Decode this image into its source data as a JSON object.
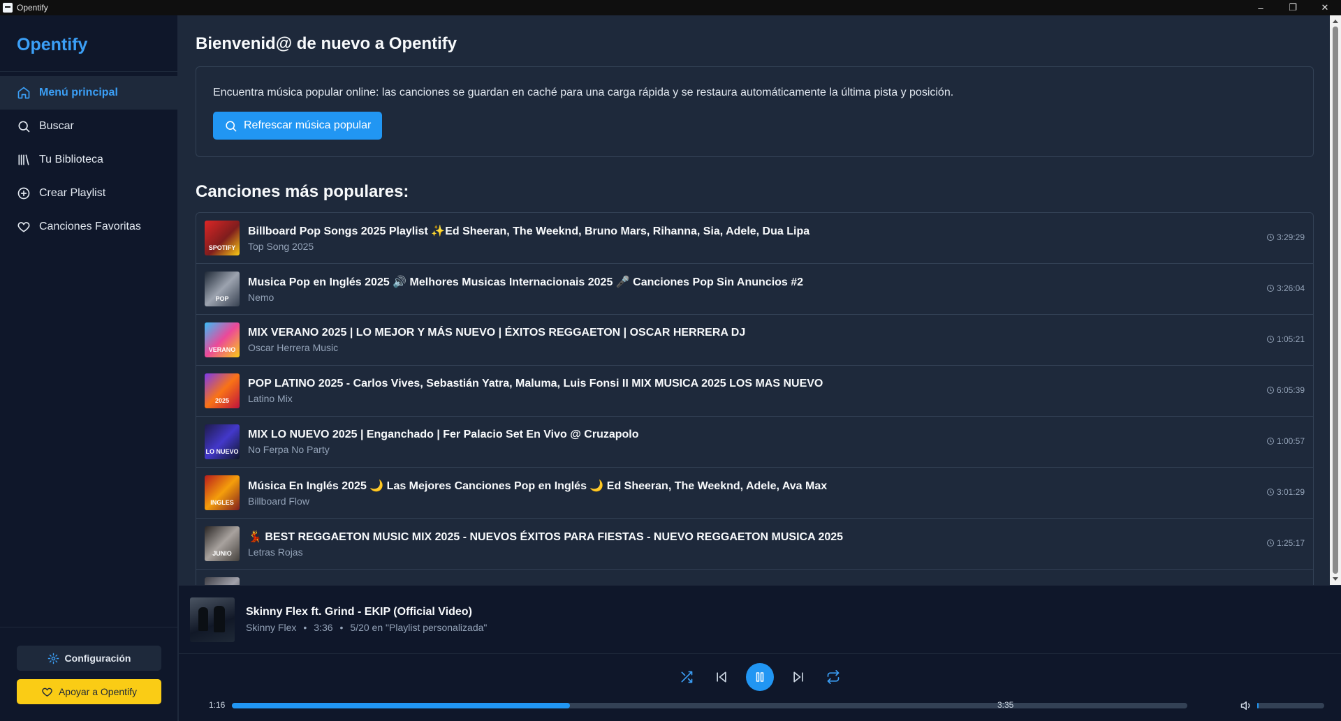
{
  "window": {
    "title": "Opentify",
    "minimize": "–",
    "maximize": "❐",
    "close": "✕"
  },
  "sidebar": {
    "brand": "Opentify",
    "items": [
      {
        "label": "Menú principal",
        "icon": "home-icon",
        "active": true
      },
      {
        "label": "Buscar",
        "icon": "search-icon"
      },
      {
        "label": "Tu Biblioteca",
        "icon": "library-icon"
      },
      {
        "label": "Crear Playlist",
        "icon": "plus-circle-icon"
      },
      {
        "label": "Canciones Favoritas",
        "icon": "heart-icon"
      }
    ],
    "config_label": "Configuración",
    "support_label": "Apoyar a Opentify"
  },
  "main": {
    "welcome": "Bienvenid@ de nuevo a Opentify",
    "info_text": "Encuentra música popular online: las canciones se guardan en caché para una carga rápida y se restaura automáticamente la última pista y posición.",
    "refresh_label": "Refrescar música popular",
    "section_title": "Canciones más populares:",
    "songs": [
      {
        "title": "Billboard Pop Songs 2025 Playlist ✨Ed Sheeran, The Weeknd, Bruno Mars, Rihanna, Sia, Adele, Dua Lipa",
        "artist": "Top Song 2025",
        "duration": "3:29:29",
        "thumb_text": "SPOTIFY"
      },
      {
        "title": "Musica Pop en Inglés 2025 🔊 Melhores Musicas Internacionais 2025 🎤 Canciones Pop Sin Anuncios #2",
        "artist": "Nemo",
        "duration": "3:26:04",
        "thumb_text": "POP"
      },
      {
        "title": "MIX VERANO 2025 | LO MEJOR Y MÁS NUEVO | ÉXITOS REGGAETON | OSCAR HERRERA DJ",
        "artist": "Oscar Herrera Music",
        "duration": "1:05:21",
        "thumb_text": "VERANO"
      },
      {
        "title": "POP LATINO 2025 - Carlos Vives, Sebastián Yatra, Maluma, Luis Fonsi II MIX MUSICA 2025 LOS MAS NUEVO",
        "artist": "Latino Mix",
        "duration": "6:05:39",
        "thumb_text": "2025"
      },
      {
        "title": "MIX LO NUEVO 2025 | Enganchado | Fer Palacio Set En Vivo @ Cruzapolo",
        "artist": "No Ferpa No Party",
        "duration": "1:00:57",
        "thumb_text": "LO NUEVO"
      },
      {
        "title": "Música En Inglés 2025 🌙 Las Mejores Canciones Pop en Inglés 🌙 Ed Sheeran, The Weeknd, Adele, Ava Max",
        "artist": "Billboard Flow",
        "duration": "3:01:29",
        "thumb_text": "INGLES"
      },
      {
        "title": "💃 BEST REGGAETON MUSIC MIX 2025 - NUEVOS ÉXITOS PARA FIESTAS - NUEVO REGGAETON MUSICA 2025",
        "artist": "Letras Rojas",
        "duration": "1:25:17",
        "thumb_text": "JUNIO"
      },
      {
        "title": "",
        "artist": "",
        "duration": "",
        "thumb_text": ""
      }
    ]
  },
  "player": {
    "title": "Skinny Flex ft. Grind - EKIP (Official Video)",
    "artist": "Skinny Flex",
    "duration": "3:36",
    "position_info": "5/20 en \"Playlist personalizada\"",
    "meta_separator": "•",
    "current_time": "1:16",
    "total_time": "3:35",
    "progress_percent": 35.4,
    "volume_percent": 2,
    "colors": {
      "accent": "#2196f3",
      "brand": "#3b9ff6",
      "support": "#facc15"
    }
  }
}
